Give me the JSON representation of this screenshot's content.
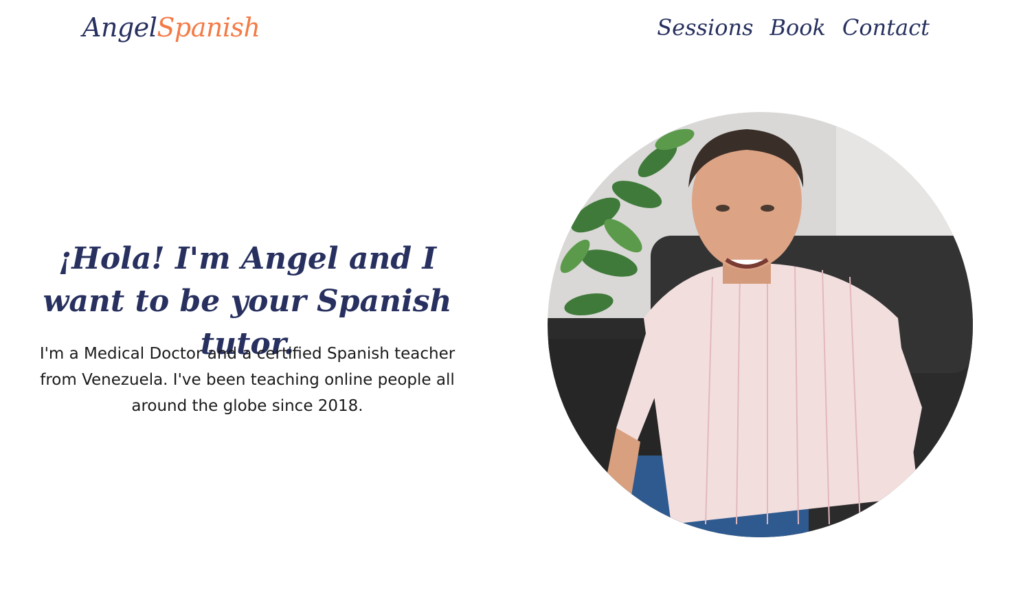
{
  "brand": {
    "name_part1": "Angel",
    "name_part2": "Spanish",
    "color_primary": "#27305f",
    "color_accent": "#f47a46"
  },
  "nav": {
    "items": [
      {
        "label": "Sessions"
      },
      {
        "label": "Book"
      },
      {
        "label": "Contact"
      }
    ]
  },
  "hero": {
    "title": "¡Hola! I'm Angel and I want to be your Spanish tutor.",
    "description": "I'm a Medical Doctor and a certified Spanish teacher from Venezuela. I've been teaching online people all around the globe since 2018.",
    "portrait_icon": "person-photo"
  }
}
